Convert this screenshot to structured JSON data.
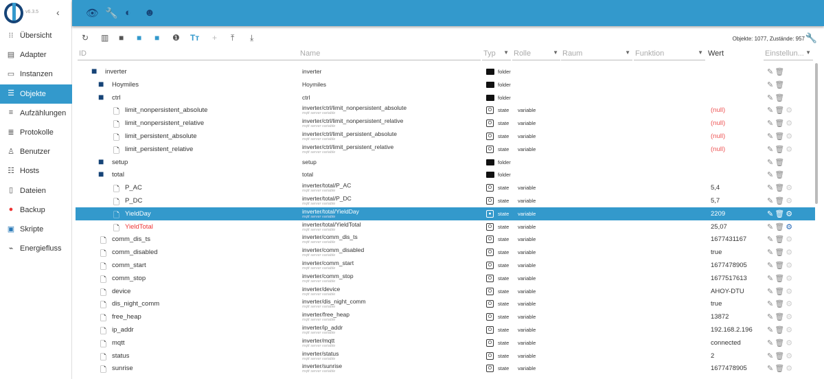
{
  "app": {
    "version": "v6.3.5"
  },
  "sidebar": {
    "items": [
      {
        "label": "Übersicht",
        "icon": "grid-icon"
      },
      {
        "label": "Adapter",
        "icon": "store-icon"
      },
      {
        "label": "Instanzen",
        "icon": "instances-icon"
      },
      {
        "label": "Objekte",
        "icon": "list-icon",
        "active": true
      },
      {
        "label": "Aufzählungen",
        "icon": "enum-icon"
      },
      {
        "label": "Protokolle",
        "icon": "log-icon"
      },
      {
        "label": "Benutzer",
        "icon": "user-icon"
      },
      {
        "label": "Hosts",
        "icon": "hosts-icon"
      },
      {
        "label": "Dateien",
        "icon": "file-icon"
      },
      {
        "label": "Backup",
        "icon": "backup-icon"
      },
      {
        "label": "Skripte",
        "icon": "script-icon"
      },
      {
        "label": "Energiefluss",
        "icon": "energy-icon"
      }
    ]
  },
  "toolbar": {
    "status": "Objekte: 1077, Zustände: 957"
  },
  "columns": {
    "id": "ID",
    "name": "Name",
    "type": "Typ",
    "role": "Rolle",
    "room": "Raum",
    "function": "Funktion",
    "value": "Wert",
    "settings": "Einstellun..."
  },
  "rows": [
    {
      "id": "inverter",
      "level": 0,
      "kind": "open",
      "name": "inverter",
      "type": "folder"
    },
    {
      "id": "Hoymiles",
      "level": 1,
      "kind": "closed",
      "name": "Hoymiles",
      "type": "folder"
    },
    {
      "id": "ctrl",
      "level": 1,
      "kind": "open",
      "name": "ctrl",
      "type": "folder"
    },
    {
      "id": "limit_nonpersistent_absolute",
      "level": 2,
      "kind": "file",
      "name": "inverter/ctrl/limit_nonpersistent_absolute",
      "desc": "mqtt server variable",
      "type": "state",
      "role": "variable",
      "value": "(null)"
    },
    {
      "id": "limit_nonpersistent_relative",
      "level": 2,
      "kind": "file",
      "name": "inverter/ctrl/limit_nonpersistent_relative",
      "desc": "mqtt server variable",
      "type": "state",
      "role": "variable",
      "value": "(null)"
    },
    {
      "id": "limit_persistent_absolute",
      "level": 2,
      "kind": "file",
      "name": "inverter/ctrl/limit_persistent_absolute",
      "desc": "mqtt server variable",
      "type": "state",
      "role": "variable",
      "value": "(null)"
    },
    {
      "id": "limit_persistent_relative",
      "level": 2,
      "kind": "file",
      "name": "inverter/ctrl/limit_persistent_relative",
      "desc": "mqtt server variable",
      "type": "state",
      "role": "variable",
      "value": "(null)"
    },
    {
      "id": "setup",
      "level": 1,
      "kind": "closed",
      "name": "setup",
      "type": "folder"
    },
    {
      "id": "total",
      "level": 1,
      "kind": "open",
      "name": "total",
      "type": "folder"
    },
    {
      "id": "P_AC",
      "level": 2,
      "kind": "file",
      "name": "inverter/total/P_AC",
      "desc": "mqtt server variable",
      "type": "state",
      "role": "variable",
      "value": "5,4"
    },
    {
      "id": "P_DC",
      "level": 2,
      "kind": "file",
      "name": "inverter/total/P_DC",
      "desc": "mqtt server variable",
      "type": "state",
      "role": "variable",
      "value": "5,7"
    },
    {
      "id": "YieldDay",
      "level": 2,
      "kind": "file",
      "name": "inverter/total/YieldDay",
      "desc": "mqtt server variable",
      "type": "state",
      "role": "variable",
      "value": "2209",
      "selected": true
    },
    {
      "id": "YieldTotal",
      "level": 2,
      "kind": "file",
      "name": "inverter/total/YieldTotal",
      "desc": "mqtt server variable",
      "type": "state",
      "role": "variable",
      "value": "25,07",
      "red": true
    },
    {
      "id": "comm_dis_ts",
      "level": 1,
      "kind": "file",
      "name": "inverter/comm_dis_ts",
      "desc": "mqtt server variable",
      "type": "state",
      "role": "variable",
      "value": "1677431167"
    },
    {
      "id": "comm_disabled",
      "level": 1,
      "kind": "file",
      "name": "inverter/comm_disabled",
      "desc": "mqtt server variable",
      "type": "state",
      "role": "variable",
      "value": "true"
    },
    {
      "id": "comm_start",
      "level": 1,
      "kind": "file",
      "name": "inverter/comm_start",
      "desc": "mqtt server variable",
      "type": "state",
      "role": "variable",
      "value": "1677478905"
    },
    {
      "id": "comm_stop",
      "level": 1,
      "kind": "file",
      "name": "inverter/comm_stop",
      "desc": "mqtt server variable",
      "type": "state",
      "role": "variable",
      "value": "1677517613"
    },
    {
      "id": "device",
      "level": 1,
      "kind": "file",
      "name": "inverter/device",
      "desc": "mqtt server variable",
      "type": "state",
      "role": "variable",
      "value": "AHOY-DTU"
    },
    {
      "id": "dis_night_comm",
      "level": 1,
      "kind": "file",
      "name": "inverter/dis_night_comm",
      "desc": "mqtt server variable",
      "type": "state",
      "role": "variable",
      "value": "true"
    },
    {
      "id": "free_heap",
      "level": 1,
      "kind": "file",
      "name": "inverter/free_heap",
      "desc": "mqtt server variable",
      "type": "state",
      "role": "variable",
      "value": "13872"
    },
    {
      "id": "ip_addr",
      "level": 1,
      "kind": "file",
      "name": "inverter/ip_addr",
      "desc": "mqtt server variable",
      "type": "state",
      "role": "variable",
      "value": "192.168.2.196"
    },
    {
      "id": "mqtt",
      "level": 1,
      "kind": "file",
      "name": "inverter/mqtt",
      "desc": "mqtt server variable",
      "type": "state",
      "role": "variable",
      "value": "connected"
    },
    {
      "id": "status",
      "level": 1,
      "kind": "file",
      "name": "inverter/status",
      "desc": "mqtt server variable",
      "type": "state",
      "role": "variable",
      "value": "2"
    },
    {
      "id": "sunrise",
      "level": 1,
      "kind": "file",
      "name": "inverter/sunrise",
      "desc": "mqtt server variable",
      "type": "state",
      "role": "variable",
      "value": "1677478905"
    }
  ],
  "colors": {
    "accent": "#3399cc",
    "brand": "#164477",
    "null": "#e55555"
  }
}
